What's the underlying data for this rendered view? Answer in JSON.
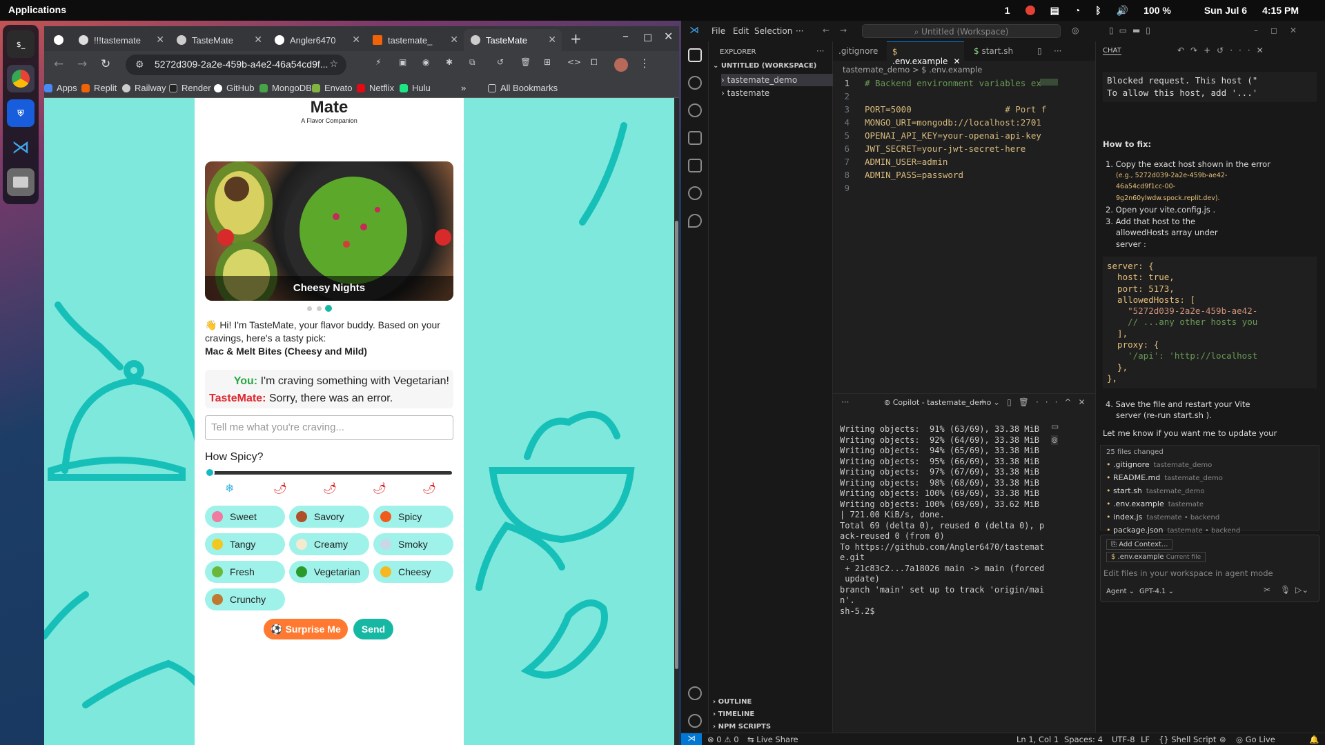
{
  "system": {
    "apps_label": "Applications",
    "tray_num": "1",
    "battery": "100 %",
    "date": "Sun Jul 6",
    "time": "4:15 PM"
  },
  "chrome": {
    "tabs": [
      {
        "label": "!!!tastemate",
        "active": false
      },
      {
        "label": "TasteMate",
        "active": false
      },
      {
        "label": "Angler6470",
        "active": false
      },
      {
        "label": "tastemate_",
        "active": false
      },
      {
        "label": "TasteMate",
        "active": true
      }
    ],
    "new_tab": "+",
    "url": "5272d309-2a2e-459b-a4e2-46a54cd9f...",
    "bookmarks": [
      "Apps",
      "Replit",
      "Railway",
      "Render",
      "GitHub",
      "MongoDB",
      "Envato",
      "Netflix",
      "Hulu"
    ],
    "bookmarks_more": "»",
    "all_bookmarks": "All Bookmarks"
  },
  "app": {
    "logo": "Mate",
    "tagline": "A Flavor Companion",
    "carousel_caption": "Cheesy Nights",
    "greeting": "👋 Hi! I'm TasteMate, your flavor buddy. Based on your cravings, here's a tasty pick:",
    "pick": "Mac & Melt Bites (Cheesy and Mild)",
    "you_label": "You:",
    "you_msg": "I'm craving something with Vegetarian!",
    "bot_label": "TasteMate:",
    "bot_msg": "Sorry, there was an error.",
    "craving_placeholder": "Tell me what you're craving...",
    "spicy_label": "How Spicy?",
    "spicy_level": 0,
    "snow": "❄",
    "chili": "🌶",
    "chips": [
      "Sweet",
      "Savory",
      "Spicy",
      "Tangy",
      "Creamy",
      "Smoky",
      "Fresh",
      "Vegetarian",
      "Cheesy",
      "Crunchy"
    ],
    "surprise_label": "Surprise Me",
    "send_label": "Send"
  },
  "vscode": {
    "menu": [
      "File",
      "Edit",
      "Selection",
      "···"
    ],
    "search": "Untitled (Workspace)",
    "explorer_title": "EXPLORER",
    "workspace": "UNTITLED (WORKSPACE)",
    "folders": [
      "tastemate_demo",
      "tastemate"
    ],
    "outline": "OUTLINE",
    "timeline": "TIMELINE",
    "npm": "NPM SCRIPTS",
    "tabs": [
      ".gitignore",
      ".env.example",
      "start.sh"
    ],
    "breadcrumb": "tastemate_demo  >  $ .env.example",
    "code": [
      {
        "n": "1",
        "t": "# Backend environment variables ex"
      },
      {
        "n": "2",
        "t": ""
      },
      {
        "n": "3",
        "t": "PORT=5000                  # Port f"
      },
      {
        "n": "4",
        "t": "MONGO_URI=mongodb://localhost:2701"
      },
      {
        "n": "5",
        "t": "OPENAI_API_KEY=your-openai-api-key"
      },
      {
        "n": "6",
        "t": "JWT_SECRET=your-jwt-secret-here"
      },
      {
        "n": "7",
        "t": "ADMIN_USER=admin"
      },
      {
        "n": "8",
        "t": "ADMIN_PASS=password"
      },
      {
        "n": "9",
        "t": ""
      }
    ],
    "terminal_title": "Copilot - tastemate_demo",
    "terminal": [
      "Writing objects:  91% (63/69), 33.38 MiB",
      "Writing objects:  92% (64/69), 33.38 MiB",
      "Writing objects:  94% (65/69), 33.38 MiB",
      "Writing objects:  95% (66/69), 33.38 MiB",
      "Writing objects:  97% (67/69), 33.38 MiB",
      "Writing objects:  98% (68/69), 33.38 MiB",
      "Writing objects: 100% (69/69), 33.38 MiB",
      "Writing objects: 100% (69/69), 33.62 MiB",
      "| 721.00 KiB/s, done.",
      "Total 69 (delta 0), reused 0 (delta 0), p",
      "ack-reused 0 (from 0)",
      "To https://github.com/Angler6470/tastemat",
      "e.git",
      " + 21c83c2...7a18026 main -> main (forced",
      " update)",
      "branch 'main' set up to track 'origin/mai",
      "n'.",
      "sh-5.2$ "
    ],
    "chat": {
      "title": "CHAT",
      "blocked1": "Blocked request. This host (\"",
      "blocked2": "To allow this host, add '...'",
      "howto": "How to fix:",
      "step1a": "Copy the exact host shown in the error",
      "step1b": "(e.g., 5272d039-2a2e-459b-ae42-",
      "step1c": "46a54cd9f1cc-00-",
      "step1d": "9g2n60ylwdw.spock.replit.dev).",
      "step2": "Open your  vite.config.js .",
      "step3a": "Add that host to the",
      "step3b": "allowedHosts  array under",
      "step3c": "server :",
      "code": [
        "server: {",
        "  host: true,",
        "  port: 5173,",
        "  allowedHosts: [",
        "    \"5272d039-2a2e-459b-ae42-",
        "    // ...any other hosts you",
        "  ],",
        "  proxy: {",
        "    '/api': 'http://localhost",
        "  },",
        "},"
      ],
      "step4a": "Save the file and restart your Vite",
      "step4b": "server (re-run  start.sh ).",
      "letme": "Let me know if you want me to update your",
      "files_changed": "25 files changed",
      "files": [
        {
          "name": ".gitignore",
          "dir": "tastemate_demo"
        },
        {
          "name": "README.md",
          "dir": "tastemate_demo"
        },
        {
          "name": "start.sh",
          "dir": "tastemate_demo"
        },
        {
          "name": ".env.example",
          "dir": "tastemate"
        },
        {
          "name": "index.js",
          "dir": "tastemate • backend"
        },
        {
          "name": "package.json",
          "dir": "tastemate • backend"
        }
      ],
      "add_context": "Add Context...",
      "current_file": ".env.example",
      "current_file_tag": "Current file",
      "input_placeholder": "Edit files in your workspace in agent mode",
      "mode": "Agent",
      "model": "GPT-4.1"
    },
    "status": {
      "errors": "0",
      "warnings": "0",
      "liveshare": "Live Share",
      "pos": "Ln 1, Col 1",
      "spaces": "Spaces: 4",
      "enc": "UTF-8",
      "eol": "LF",
      "lang": "Shell Script",
      "golive": "Go Live"
    }
  },
  "colors": {
    "accent_teal": "#16b8c4",
    "chip_bg": "#9ff2ea",
    "page_bg": "#7fe8dc",
    "surprise": "#ff7a30",
    "send": "#16b8a4",
    "you": "#27a844",
    "bot": "#e0282e"
  }
}
